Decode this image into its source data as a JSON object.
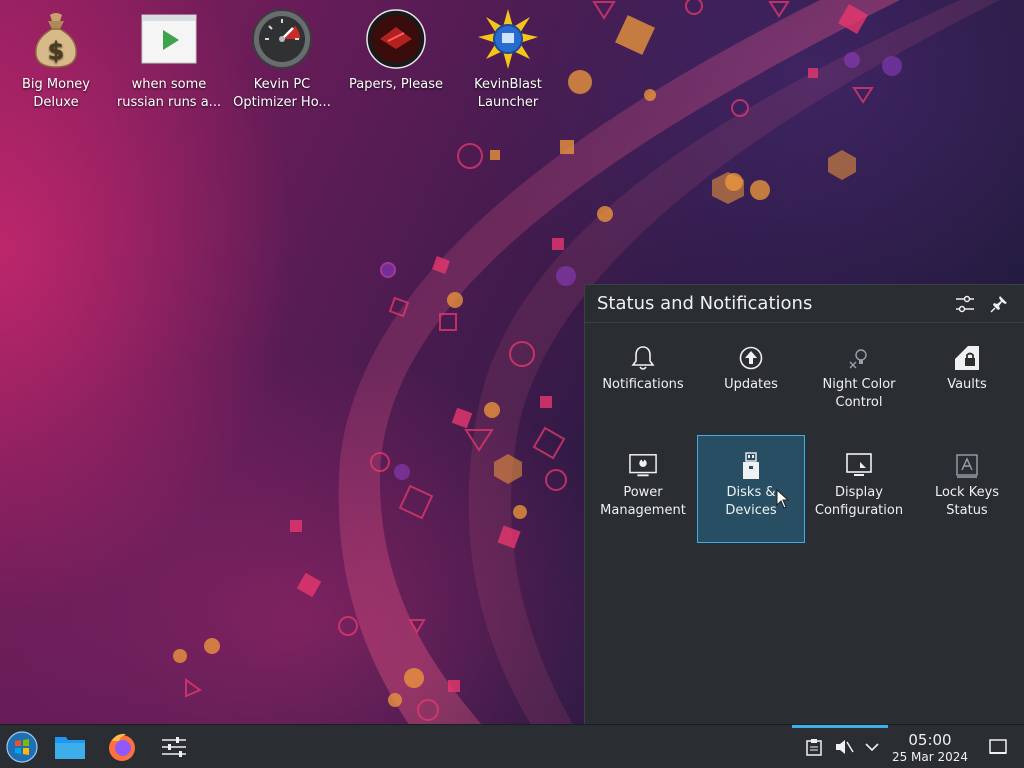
{
  "desktop": {
    "icons": [
      {
        "label_line1": "Big Money",
        "label_line2": "Deluxe",
        "icon": "money-bag-icon"
      },
      {
        "label_line1": "when some",
        "label_line2": "russian runs a...",
        "icon": "video-player-icon"
      },
      {
        "label_line1": "Kevin PC",
        "label_line2": "Optimizer Ho...",
        "icon": "speedometer-icon"
      },
      {
        "label_line1": "Papers, Please",
        "label_line2": "",
        "icon": "papers-please-icon"
      },
      {
        "label_line1": "KevinBlast",
        "label_line2": "Launcher",
        "icon": "starburst-disk-icon"
      }
    ]
  },
  "popup": {
    "title": "Status and Notifications",
    "configure_icon": "sliders-icon",
    "pin_icon": "pin-icon",
    "items": [
      {
        "label_line1": "Notifications",
        "label_line2": "",
        "icon": "bell-icon"
      },
      {
        "label_line1": "Updates",
        "label_line2": "",
        "icon": "update-arrow-icon"
      },
      {
        "label_line1": "Night Color",
        "label_line2": "Control",
        "icon": "night-color-bulb-icon"
      },
      {
        "label_line1": "Vaults",
        "label_line2": "",
        "icon": "vault-lock-icon"
      },
      {
        "label_line1": "Power",
        "label_line2": "Management",
        "icon": "monitor-power-icon"
      },
      {
        "label_line1": "Disks & Devices",
        "label_line2": "",
        "icon": "usb-drive-icon",
        "selected": true
      },
      {
        "label_line1": "Display",
        "label_line2": "Configuration",
        "icon": "display-config-icon"
      },
      {
        "label_line1": "Lock Keys",
        "label_line2": "Status",
        "icon": "lock-keys-icon"
      }
    ]
  },
  "taskbar": {
    "launchers": [
      {
        "name": "start-menu",
        "icon": "windows-orb-icon"
      },
      {
        "name": "file-manager",
        "icon": "folder-icon"
      },
      {
        "name": "firefox",
        "icon": "firefox-icon"
      },
      {
        "name": "system-settings",
        "icon": "settings-sliders-icon"
      }
    ],
    "tray": [
      {
        "name": "clipboard",
        "icon": "clipboard-icon"
      },
      {
        "name": "volume",
        "icon": "volume-muted-icon"
      },
      {
        "name": "expand",
        "icon": "chevron-down-icon"
      }
    ],
    "clock": {
      "time": "05:00",
      "date": "25 Mar 2024"
    },
    "show_desktop_icon": "show-desktop-icon"
  },
  "colors": {
    "accent": "#3daee9",
    "panel_bg": "#2a2e32",
    "selected_bg": "#284e63",
    "text": "#eff0f1"
  }
}
